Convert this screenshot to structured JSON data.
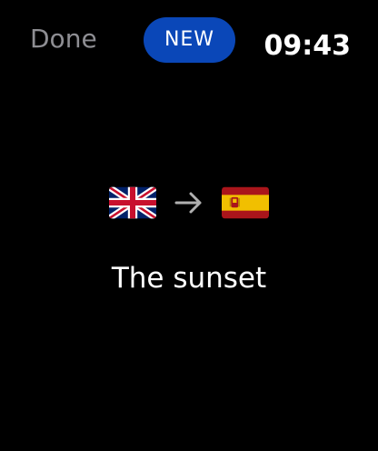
{
  "header": {
    "done_label": "Done",
    "new_label": "NEW",
    "time": "09:43"
  },
  "translation": {
    "source_flag_icon": "uk-flag-icon",
    "arrow_icon": "right-arrow-icon",
    "target_flag_icon": "spain-flag-icon",
    "phrase": "The sunset"
  },
  "colors": {
    "background": "#000000",
    "accent": "#0a47b8",
    "done_text": "#8e8e93",
    "text": "#ffffff"
  }
}
